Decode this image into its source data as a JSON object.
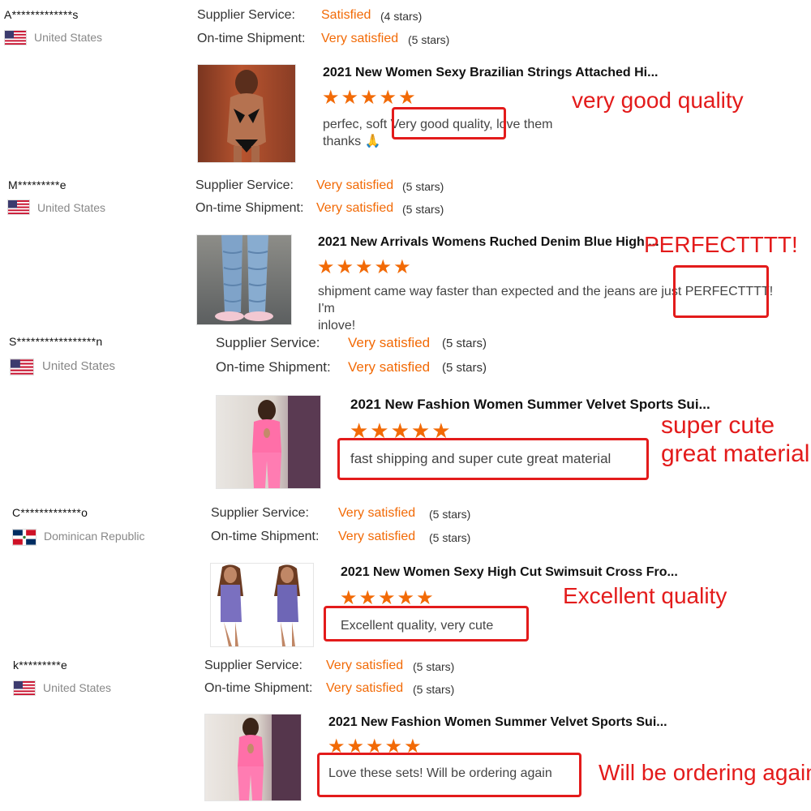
{
  "labels": {
    "supplier_service": "Supplier Service:",
    "on_time_shipment": "On-time Shipment:"
  },
  "colors": {
    "accent_orange": "#f26a06",
    "annotation_red": "#e31b1b"
  },
  "reviews": [
    {
      "username": "A*************s",
      "country": "United States",
      "flag": "us-flag",
      "supplier_value": "Satisfied",
      "supplier_stars": "(4 stars)",
      "shipment_value": "Very satisfied",
      "shipment_stars": "(5 stars)",
      "product_title": "2021 New Women Sexy Brazilian Strings Attached Hi...",
      "rating": "★★★★★",
      "comment_before": "perfec,  soft",
      "comment_highlight": "Very good quality,",
      "comment_after": "love them",
      "comment_line2": "thanks 🙏",
      "annotation": "very good quality"
    },
    {
      "username": "M*********e",
      "country": "United States",
      "flag": "us-flag",
      "supplier_value": "Very satisfied",
      "supplier_stars": "(5 stars)",
      "shipment_value": "Very satisfied",
      "shipment_stars": "(5 stars)",
      "product_title": "2021 New Arrivals Womens Ruched Denim Blue High ...",
      "rating": "★★★★★",
      "comment_before": "shipment came way faster than expected and the jeans are just",
      "comment_highlight": "PERFECTTTT!",
      "comment_after": "I'm",
      "comment_line2": "inlove!",
      "annotation": "PERFECTTTT!"
    },
    {
      "username": "S*****************n",
      "country": "United States",
      "flag": "us-flag",
      "supplier_value": "Very satisfied",
      "supplier_stars": "(5 stars)",
      "shipment_value": "Very satisfied",
      "shipment_stars": "(5 stars)",
      "product_title": "2021 New Fashion Women Summer Velvet Sports Sui...",
      "rating": "★★★★★",
      "comment": "fast shipping and super cute great material",
      "annotation_line1": "super cute",
      "annotation_line2": "great material"
    },
    {
      "username": "C*************o",
      "country": "Dominican Republic",
      "flag": "dominican-republic-flag",
      "supplier_value": "Very satisfied",
      "supplier_stars": "(5 stars)",
      "shipment_value": "Very satisfied",
      "shipment_stars": "(5 stars)",
      "product_title": "2021 New Women Sexy High Cut Swimsuit Cross Fro...",
      "rating": "★★★★★",
      "comment": "Excellent quality, very cute",
      "annotation": "Excellent quality"
    },
    {
      "username": "k*********e",
      "country": "United States",
      "flag": "us-flag",
      "supplier_value": "Very satisfied",
      "supplier_stars": "(5 stars)",
      "shipment_value": "Very satisfied",
      "shipment_stars": "(5 stars)",
      "product_title": "2021 New Fashion Women Summer Velvet Sports Sui...",
      "rating": "★★★★★",
      "comment": "Love these sets! Will be ordering again",
      "annotation": "Will be ordering again"
    }
  ]
}
